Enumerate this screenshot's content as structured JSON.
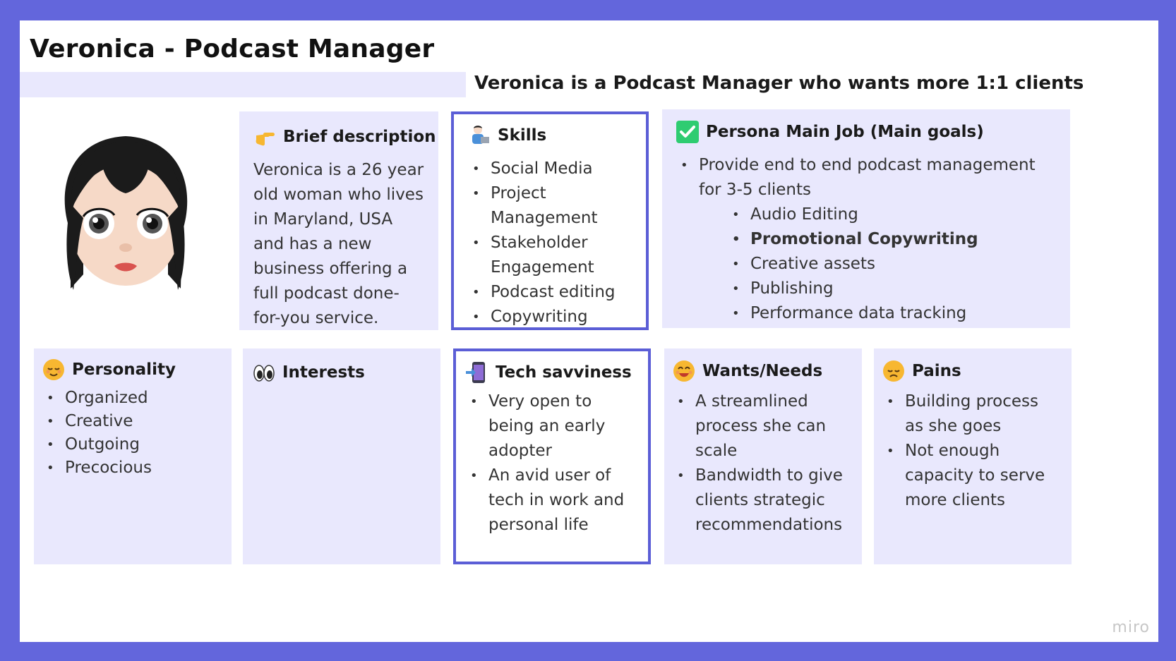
{
  "title": "Veronica - Podcast Manager",
  "subtitle": "Veronica is a Podcast Manager who wants more 1:1 clients",
  "cards": {
    "brief": {
      "icon": "pointing-hand-icon",
      "heading": "Brief description",
      "text": "Veronica is a 26 year old woman who lives in Maryland, USA and has a new business offering a full podcast done-for-you service."
    },
    "skills": {
      "icon": "technologist-icon",
      "heading": "Skills",
      "items": [
        "Social Media",
        "Project Management",
        "Stakeholder Engagement",
        "Podcast editing",
        "Copywriting"
      ]
    },
    "main_job": {
      "icon": "check-mark-icon",
      "heading": "Persona Main Job (Main goals)",
      "items": [
        "Provide end to end podcast management for 3-5 clients"
      ],
      "sub_items": [
        "Audio Editing",
        "Promotional Copywriting",
        "Creative assets",
        "Publishing",
        "Performance data tracking"
      ]
    },
    "personality": {
      "icon": "relieved-face-icon",
      "heading": "Personality",
      "items": [
        "Organized",
        "Creative",
        "Outgoing",
        "Precocious"
      ]
    },
    "interests": {
      "icon": "eyes-icon",
      "heading": "Interests"
    },
    "tech": {
      "icon": "mobile-arrow-icon",
      "heading": "Tech savviness",
      "items": [
        "Very open to being an early adopter",
        "An avid user of tech in work and personal life"
      ]
    },
    "wants": {
      "icon": "smiling-face-icon",
      "heading": "Wants/Needs",
      "items": [
        "A streamlined process she can scale",
        "Bandwidth to give clients strategic recommendations"
      ]
    },
    "pains": {
      "icon": "disappointed-face-icon",
      "heading": "Pains",
      "items": [
        "Building process as she goes",
        "Not enough capacity to serve more clients"
      ]
    }
  },
  "watermark": "miro",
  "colors": {
    "frame": "#6366dc",
    "card": "#e9e8fd",
    "outline": "#5b5ed6"
  }
}
